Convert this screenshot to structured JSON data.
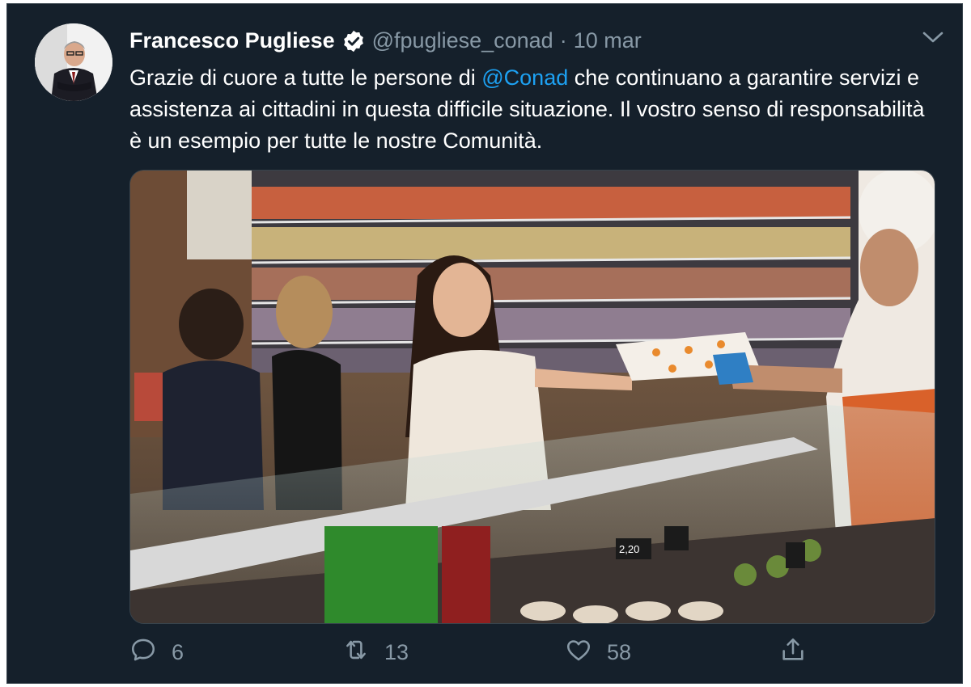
{
  "tweet": {
    "author": {
      "display_name": "Francesco Pugliese",
      "handle": "@fpugliese_conad",
      "verified": true,
      "avatar_icon": "profile-photo"
    },
    "separator": "·",
    "date": "10 mar",
    "text": {
      "part1": "Grazie di cuore a tutte le persone di ",
      "mention": "@Conad",
      "part2": " che continuano a garantire servizi e assistenza ai cittadini in questa difficile situazione. Il vostro senso di responsabilità è un esempio per tutte le nostre Comunità."
    },
    "media": {
      "type": "photo",
      "price_tag": "2,20"
    },
    "actions": {
      "reply": {
        "icon": "reply-icon",
        "count": "6"
      },
      "retweet": {
        "icon": "retweet-icon",
        "count": "13"
      },
      "like": {
        "icon": "heart-icon",
        "count": "58"
      },
      "share": {
        "icon": "share-icon"
      }
    }
  },
  "colors": {
    "background": "#15202b",
    "text_primary": "#ffffff",
    "text_secondary": "#8899a6",
    "accent": "#1da1f2"
  }
}
